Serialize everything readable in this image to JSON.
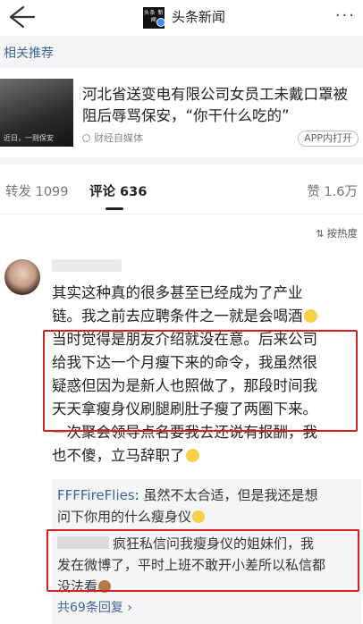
{
  "app": {
    "title": "头条新闻",
    "logo_text": "头条 新闻",
    "more": "···"
  },
  "related": {
    "header": "相关推荐",
    "article": {
      "title": "河北省送变电有限公司女员工未戴口罩被阻后辱骂保安，“你干什么吃的”",
      "thumb_caption": "近日，一则保安",
      "source": "财经自媒体",
      "open_button": "APP内打开"
    }
  },
  "tabs": [
    {
      "label": "转发 1099"
    },
    {
      "label": "评论 636"
    },
    {
      "label": "赞 1.6万"
    }
  ],
  "sort": {
    "label": "按热度"
  },
  "comment": {
    "lines": [
      "其实这种真的很多甚至已经成为了产业",
      "链。我之前去应聘条件之一就是会喝酒",
      "当时觉得是朋友介绍就没在意。后来公司",
      "给我下达一个月瘦下来的命令，我虽然很",
      "疑惑但因为是新人也照做了，那段时间我",
      "天天拿瘦身仪刷腿刷肚子瘦了两圈下来。",
      "一次聚会领导点名要我去还说有报酬，我",
      "也不傻，立马辞职了"
    ]
  },
  "replies": [
    {
      "user": "FFFFireFlies",
      "sep": ": ",
      "line1": "虽然不太合适，但是我还是想",
      "line2": "问下你用的什么瘦身仪"
    },
    {
      "line1": "疯狂私信问我瘦身仪的姐妹们，我",
      "line2": "发在微博了，平时上班不敢开小差所以私信都",
      "line3": "没法看"
    }
  ],
  "more_replies": "共69条回复 ›",
  "colors": {
    "accent": "#406599",
    "highlight": "#d32020",
    "background_gray": "#f4f5f6"
  }
}
